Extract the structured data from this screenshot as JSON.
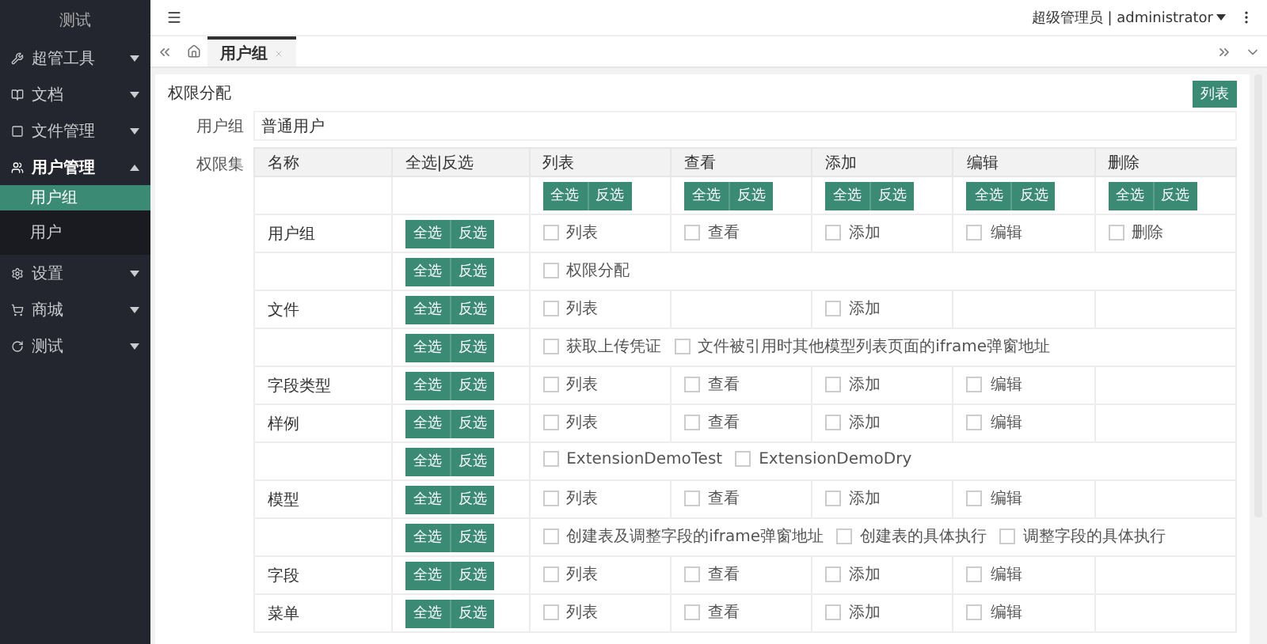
{
  "sidebar": {
    "title": "测试",
    "items": [
      {
        "label": "超管工具",
        "expanded": false
      },
      {
        "label": "文档",
        "expanded": false
      },
      {
        "label": "文件管理",
        "expanded": false
      },
      {
        "label": "用户管理",
        "expanded": true,
        "children": [
          {
            "label": "用户组",
            "selected": true
          },
          {
            "label": "用户",
            "selected": false
          }
        ]
      },
      {
        "label": "设置",
        "expanded": false
      },
      {
        "label": "商城",
        "expanded": false
      },
      {
        "label": "测试",
        "expanded": false
      }
    ]
  },
  "header": {
    "user": "超级管理员 | administrator"
  },
  "tabs": [
    {
      "label": "用户组",
      "selected": true
    }
  ],
  "panel": {
    "title": "权限分配",
    "list_button": "列表",
    "group_label": "用户组",
    "group_value": "普通用户",
    "permissions_label": "权限集",
    "table": {
      "columns": [
        "名称",
        "全选|反选",
        "列表",
        "查看",
        "添加",
        "编辑",
        "删除"
      ],
      "column_buttons": [
        [
          "全选",
          "反选"
        ],
        [
          "全选",
          "反选"
        ],
        [
          "全选",
          "反选"
        ],
        [
          "全选",
          "反选"
        ],
        [
          "全选",
          "反选"
        ]
      ],
      "rows": [
        {
          "kind": "grid",
          "name": "用户组",
          "buttons": [
            "全选",
            "反选"
          ],
          "cells": [
            {
              "label": "列表",
              "checked": false
            },
            {
              "label": "查看",
              "checked": false
            },
            {
              "label": "添加",
              "checked": false
            },
            {
              "label": "编辑",
              "checked": false
            },
            {
              "label": "删除",
              "checked": false
            }
          ]
        },
        {
          "kind": "span",
          "buttons": [
            "全选",
            "反选"
          ],
          "items": [
            {
              "label": "权限分配",
              "checked": false
            }
          ]
        },
        {
          "kind": "grid",
          "name": "文件",
          "buttons": [
            "全选",
            "反选"
          ],
          "cells": [
            {
              "label": "列表",
              "checked": false
            },
            null,
            {
              "label": "添加",
              "checked": false
            },
            null,
            null
          ]
        },
        {
          "kind": "span",
          "buttons": [
            "全选",
            "反选"
          ],
          "items": [
            {
              "label": "获取上传凭证",
              "checked": false
            },
            {
              "label": "文件被引用时其他模型列表页面的iframe弹窗地址",
              "checked": false
            }
          ]
        },
        {
          "kind": "grid",
          "name": "字段类型",
          "buttons": [
            "全选",
            "反选"
          ],
          "cells": [
            {
              "label": "列表",
              "checked": false
            },
            {
              "label": "查看",
              "checked": false
            },
            {
              "label": "添加",
              "checked": false
            },
            {
              "label": "编辑",
              "checked": false
            },
            null
          ]
        },
        {
          "kind": "grid",
          "name": "样例",
          "buttons": [
            "全选",
            "反选"
          ],
          "cells": [
            {
              "label": "列表",
              "checked": false
            },
            {
              "label": "查看",
              "checked": false
            },
            {
              "label": "添加",
              "checked": false
            },
            {
              "label": "编辑",
              "checked": false
            },
            null
          ]
        },
        {
          "kind": "span",
          "buttons": [
            "全选",
            "反选"
          ],
          "items": [
            {
              "label": "ExtensionDemoTest",
              "checked": false
            },
            {
              "label": "ExtensionDemoDry",
              "checked": false
            }
          ]
        },
        {
          "kind": "grid",
          "name": "模型",
          "buttons": [
            "全选",
            "反选"
          ],
          "cells": [
            {
              "label": "列表",
              "checked": false
            },
            {
              "label": "查看",
              "checked": false
            },
            {
              "label": "添加",
              "checked": false
            },
            {
              "label": "编辑",
              "checked": false
            },
            null
          ]
        },
        {
          "kind": "span",
          "buttons": [
            "全选",
            "反选"
          ],
          "items": [
            {
              "label": "创建表及调整字段的iframe弹窗地址",
              "checked": false
            },
            {
              "label": "创建表的具体执行",
              "checked": false
            },
            {
              "label": "调整字段的具体执行",
              "checked": false
            }
          ]
        },
        {
          "kind": "grid",
          "name": "字段",
          "buttons": [
            "全选",
            "反选"
          ],
          "cells": [
            {
              "label": "列表",
              "checked": false
            },
            {
              "label": "查看",
              "checked": false
            },
            {
              "label": "添加",
              "checked": false
            },
            {
              "label": "编辑",
              "checked": false
            },
            null
          ]
        },
        {
          "kind": "grid",
          "name": "菜单",
          "buttons": [
            "全选",
            "反选"
          ],
          "cells": [
            {
              "label": "列表",
              "checked": false
            },
            {
              "label": "查看",
              "checked": false
            },
            {
              "label": "添加",
              "checked": false
            },
            {
              "label": "编辑",
              "checked": false
            },
            null
          ]
        }
      ]
    }
  }
}
